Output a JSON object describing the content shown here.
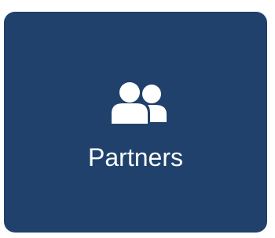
{
  "tile": {
    "label": "Partners",
    "icon": "users-icon",
    "background_color": "#1f416b",
    "text_color": "#ffffff"
  }
}
